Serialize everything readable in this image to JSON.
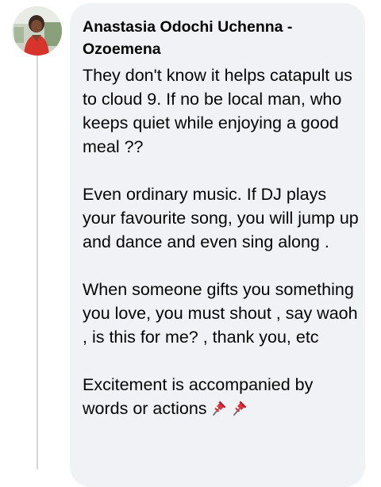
{
  "comment": {
    "author": "Anastasia Odochi Uchenna - Ozoemena",
    "paragraphs": [
      "They don't know it helps catapult us to cloud 9. If no be local man, who keeps quiet while enjoying a good meal ??",
      "Even ordinary music. If DJ plays your favourite song, you will jump up and dance and even sing along .",
      "When someone gifts you something you love, you must shout , say waoh , is this for me? , thank you, etc",
      "Excitement is accompanied by words or actions"
    ],
    "trailing_emoji": [
      "pushpin-icon",
      "pushpin-icon"
    ]
  },
  "colors": {
    "bubble_background": "#f0f2f5",
    "text": "#050505",
    "thread_line": "#d4d6da"
  }
}
